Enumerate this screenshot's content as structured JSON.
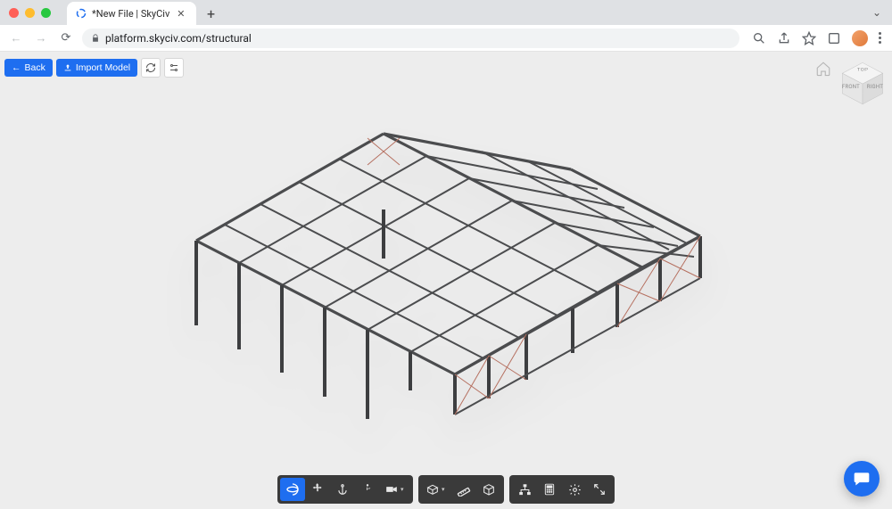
{
  "browser": {
    "tab_title": "*New File | SkyCiv",
    "url": "platform.skyciv.com/structural"
  },
  "app": {
    "back_label": "Back",
    "import_label": "Import Model"
  },
  "viewcube": {
    "top": "TOP",
    "front": "FRONT",
    "right": "RIGHT"
  },
  "toolbar1_tooltips": [
    "orbit",
    "pan",
    "move",
    "walk",
    "camera"
  ],
  "toolbar2_tooltips": [
    "extrude",
    "measure",
    "box"
  ],
  "toolbar3_tooltips": [
    "graph",
    "calculator",
    "settings",
    "expand"
  ]
}
